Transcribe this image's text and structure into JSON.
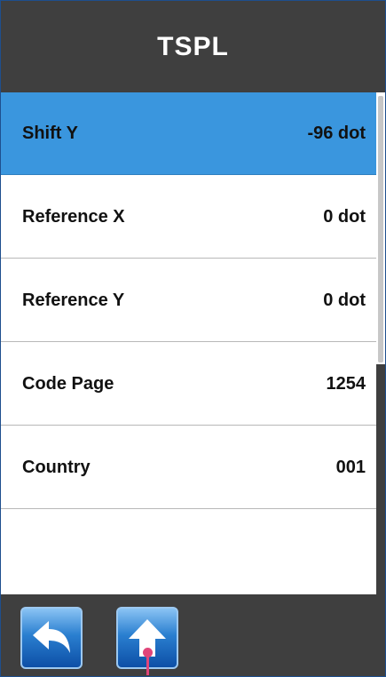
{
  "header": {
    "title": "TSPL"
  },
  "list": {
    "items": [
      {
        "label": "Shift Y",
        "value": "-96 dot",
        "selected": true
      },
      {
        "label": "Reference X",
        "value": "0 dot",
        "selected": false
      },
      {
        "label": "Reference Y",
        "value": "0 dot",
        "selected": false
      },
      {
        "label": "Code Page",
        "value": "1254",
        "selected": false
      },
      {
        "label": "Country",
        "value": "001",
        "selected": false
      }
    ]
  },
  "toolbar": {
    "back_icon": "back-arrow-icon",
    "up_icon": "up-arrow-icon"
  },
  "colors": {
    "header_bg": "#3f3f3f",
    "selected_row": "#3a96de",
    "button_gradient_top": "#8ac3f4",
    "button_gradient_bottom": "#0d4fa6",
    "touch_indicator": "#e0457a"
  }
}
